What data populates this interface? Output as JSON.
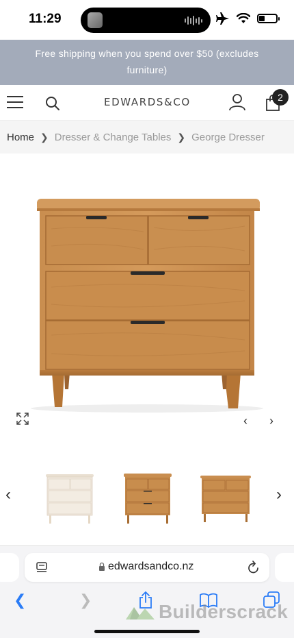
{
  "status_bar": {
    "time": "11:29",
    "battery_level": 0.35
  },
  "promo": {
    "text": "Free shipping when you spend over $50 (excludes furniture)"
  },
  "header": {
    "logo": "EDWARDS&CO",
    "cart_count": "2"
  },
  "breadcrumb": {
    "home": "Home",
    "category": "Dresser & Change Tables",
    "current": "George Dresser"
  },
  "gallery": {
    "thumbnails": [
      {
        "variant": "white"
      },
      {
        "variant": "oak"
      },
      {
        "variant": "oak"
      }
    ],
    "colors": {
      "oak": "#c58a4a",
      "oak_dark": "#a86e34",
      "white": "#efe7dc",
      "handle": "#2a2a2a"
    }
  },
  "browser": {
    "url": "edwardsandco.nz",
    "watermark": "Builderscrack"
  },
  "colors": {
    "promo_bg": "#a3abba",
    "accent": "#2b7cf6"
  }
}
